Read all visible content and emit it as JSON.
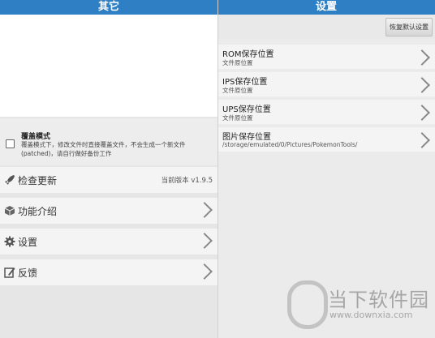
{
  "left": {
    "header_title": "其它",
    "overwrite": {
      "title": "覆盖模式",
      "description": "覆盖模式下，修改文件时直接覆盖文件，不会生成一个新文件(patched)，请自行做好备份工作"
    },
    "menu": [
      {
        "label": "检查更新",
        "icon": "rocket-icon",
        "version": "当前版本 v1.9.5"
      },
      {
        "label": "功能介绍",
        "icon": "cube-icon"
      },
      {
        "label": "设置",
        "icon": "gear-icon"
      },
      {
        "label": "反馈",
        "icon": "feedback-icon"
      }
    ]
  },
  "right": {
    "header_title": "设置",
    "reset_button": "恢复默认设置",
    "settings": [
      {
        "title": "ROM保存位置",
        "sub": "文件原位置"
      },
      {
        "title": "IPS保存位置",
        "sub": "文件原位置"
      },
      {
        "title": "UPS保存位置",
        "sub": "文件原位置"
      },
      {
        "title": "图片保存位置",
        "sub": "/storage/emulated/0/Pictures/PokemonTools/"
      }
    ]
  },
  "watermark": {
    "name": "当下软件园",
    "url": "www.downxia.com"
  },
  "colors": {
    "header": "#2f7fc5"
  }
}
